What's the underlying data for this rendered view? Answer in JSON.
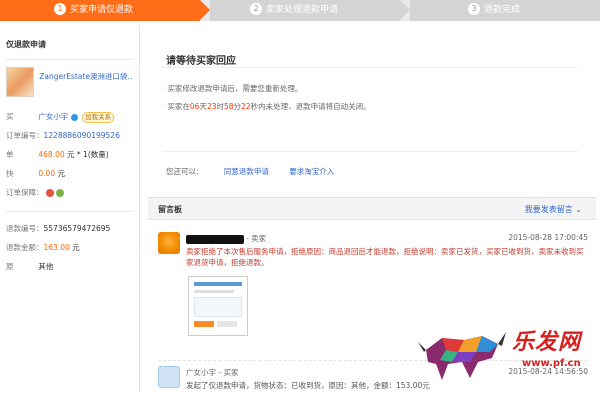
{
  "steps": [
    {
      "num": "1",
      "label": "买家申请仅退款",
      "state": "active"
    },
    {
      "num": "2",
      "label": "卖家处理退款申请",
      "state": "pending"
    },
    {
      "num": "3",
      "label": "退款完成",
      "state": "pending"
    }
  ],
  "colors": {
    "accent": "#ff6d18",
    "link": "#3366cc",
    "highlight": "#ff3300",
    "step_inactive": "#d4d4d4"
  },
  "left": {
    "title": "仅退款申请",
    "product_name": "ZangerEstate澳洲进口袋...",
    "seller_label": "买",
    "seller_value": "广女小宇",
    "seller_tag": "加我关系",
    "order_no_label": "订单编号：",
    "order_no_value": "1228886090199526",
    "price_label": "单",
    "price_value": "468.00",
    "price_unit": "元 * 1(数量)",
    "shipping_label": "快",
    "shipping_value": "0.00",
    "shipping_unit": "元",
    "guarantee_label": "订单保障：",
    "refund_no_label": "退款编号：",
    "refund_no_value": "55736579472695",
    "refund_amount_label": "退款金额：",
    "refund_amount_value": "163.00",
    "refund_amount_unit": "元",
    "reason_label": "原",
    "reason_value": "其他"
  },
  "main": {
    "title": "请等待买家回应",
    "bullet1": "买家修改退款申请后，需要您重新处理。",
    "bullet2_pre": "买家在",
    "bullet2_days": "06",
    "bullet2_d": "天",
    "bullet2_hours": "23",
    "bullet2_h": "时",
    "bullet2_mins": "58",
    "bullet2_m": "分",
    "bullet2_secs": "22",
    "bullet2_post": "秒内未处理，退款申请将自动关闭。",
    "actions_label": "您还可以：",
    "action_agree": "同意退款申请",
    "action_intervene": "要求淘宝介入"
  },
  "board": {
    "title": "留言板",
    "link": "我要发表留言",
    "msg1_name": "- 卖家",
    "msg1_time": "2015-08-28 17:00:45",
    "msg1_text": "卖家拒绝了本次售后服务申请，拒绝原因：商品退回后才能退款，拒绝说明：卖家已发货，买家已收到货，卖家未收到买家退货申请，拒绝退款。",
    "msg2_name": "广女小宇 - 买家",
    "msg2_time": "2015-08-24 14:56:50",
    "msg2_text": "发起了仅退款申请，货物状态：已收到货，原因：其他，金额：153.00元"
  },
  "watermark": {
    "text": "乐发网",
    "url": "www.pf.cn"
  }
}
